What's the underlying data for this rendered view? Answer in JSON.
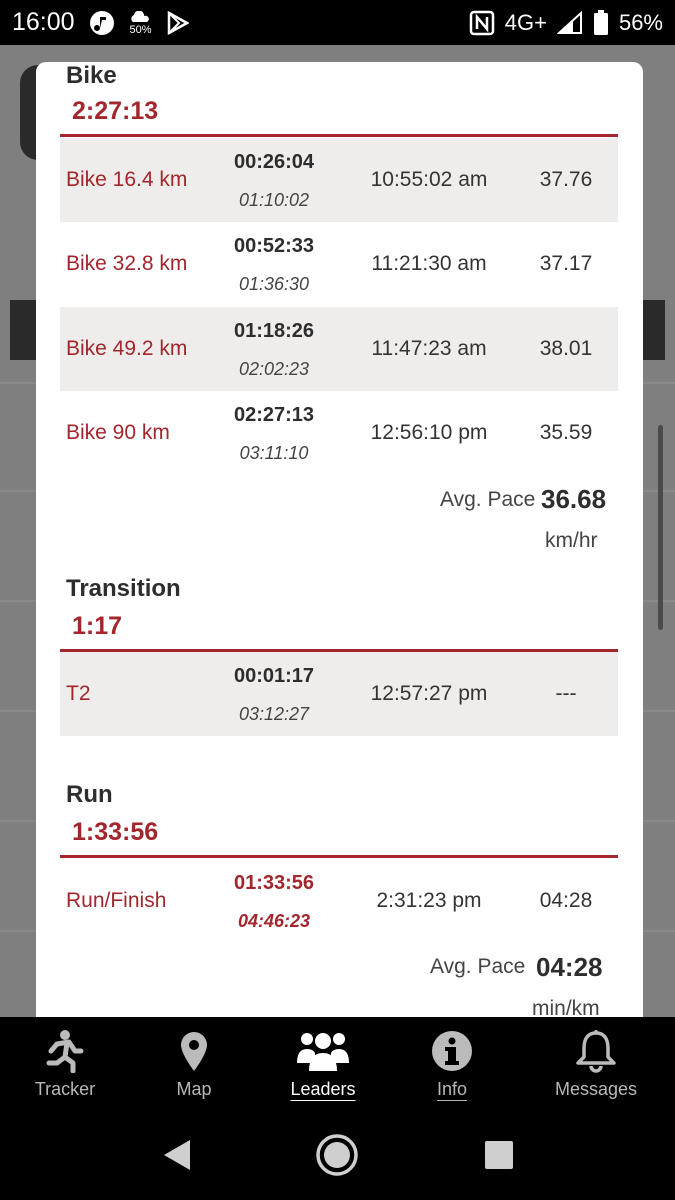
{
  "status_bar": {
    "time": "16:00",
    "left_icons": [
      "music-note-icon",
      "weather-icon",
      "play-store-icon"
    ],
    "weather_percent": "50%",
    "network": "4G+",
    "battery": "56%",
    "right_icons": [
      "nfc-icon",
      "signal-icon",
      "battery-icon"
    ]
  },
  "sections": {
    "bike": {
      "title": "Bike",
      "total": "2:27:13",
      "rows": [
        {
          "name": "Bike 16.4 km",
          "split": "00:26:04",
          "cumulative": "01:10:02",
          "clock": "10:55:02 am",
          "pace": "37.76"
        },
        {
          "name": "Bike 32.8 km",
          "split": "00:52:33",
          "cumulative": "01:36:30",
          "clock": "11:21:30 am",
          "pace": "37.17"
        },
        {
          "name": "Bike 49.2 km",
          "split": "01:18:26",
          "cumulative": "02:02:23",
          "clock": "11:47:23 am",
          "pace": "38.01"
        },
        {
          "name": "Bike 90 km",
          "split": "02:27:13",
          "cumulative": "03:11:10",
          "clock": "12:56:10 pm",
          "pace": "35.59"
        }
      ],
      "avg_label": "Avg. Pace",
      "avg_value": "36.68",
      "avg_unit": "km/hr"
    },
    "transition": {
      "title": "Transition",
      "total": "1:17",
      "rows": [
        {
          "name": "T2",
          "split": "00:01:17",
          "cumulative": "03:12:27",
          "clock": "12:57:27 pm",
          "pace": "---"
        }
      ]
    },
    "run": {
      "title": "Run",
      "total": "1:33:56",
      "rows": [
        {
          "name": "Run/Finish",
          "split": "01:33:56",
          "cumulative": "04:46:23",
          "clock": "2:31:23 pm",
          "pace": "04:28"
        }
      ],
      "avg_label": "Avg. Pace",
      "avg_value": "04:28",
      "avg_unit": "min/km"
    }
  },
  "tabbar": {
    "tabs": [
      {
        "label": "Tracker",
        "icon": "runner-icon"
      },
      {
        "label": "Map",
        "icon": "map-pin-icon"
      },
      {
        "label": "Leaders",
        "icon": "group-icon",
        "active": true
      },
      {
        "label": "Info",
        "icon": "info-icon"
      },
      {
        "label": "Messages",
        "icon": "bell-icon"
      }
    ]
  },
  "system_nav": {
    "buttons": [
      "back-icon",
      "home-icon",
      "recents-icon"
    ]
  },
  "colors": {
    "accent": "#a3262c",
    "row_shade": "#efedeb",
    "text_dark": "#2d2d2d"
  }
}
